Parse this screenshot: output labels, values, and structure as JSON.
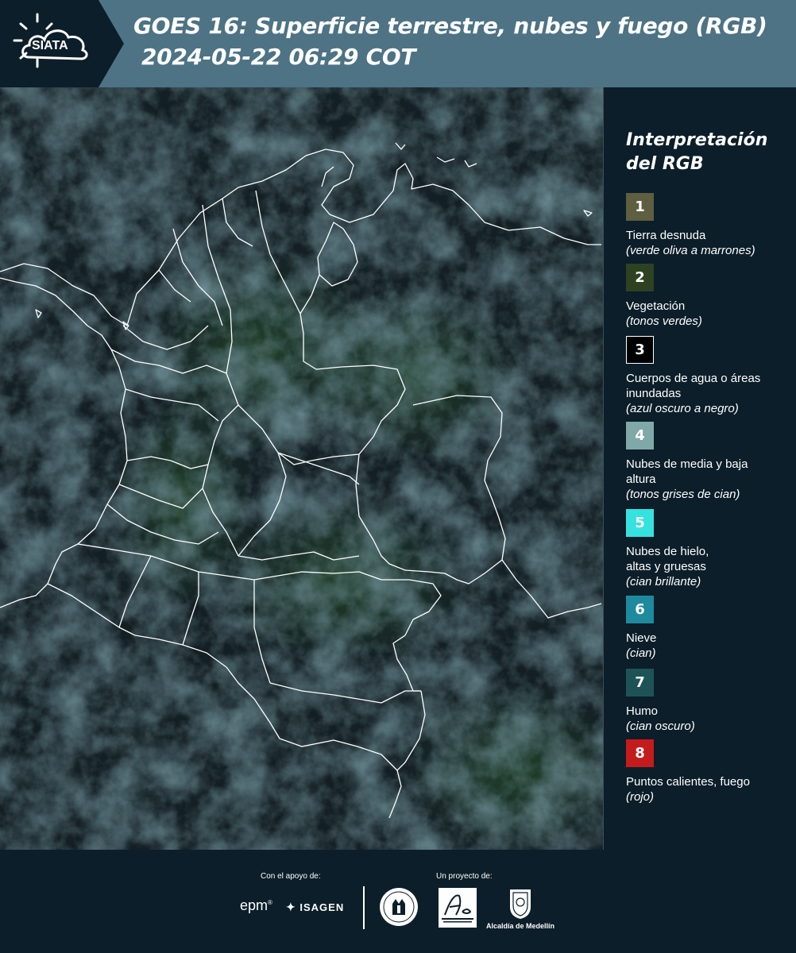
{
  "header": {
    "logo_text": "SIATA",
    "title_line1": "GOES 16: Superficie terrestre, nubes y fuego (RGB)",
    "title_line2": "2024-05-22 06:29 COT",
    "colors": {
      "bar": "#4d7384",
      "logo_bg": "#0c1e29"
    }
  },
  "map": {
    "icon": "satellite-rgb-image",
    "colors": {
      "land": "#1a2a2c",
      "vegetation": "#1d3326",
      "cloud": "#2b4a55",
      "borders": "#ffffff"
    }
  },
  "legend": {
    "title": "Interpretación del RGB",
    "items": [
      {
        "number": "1",
        "color": "#5e5e40",
        "label": "Tierra desnuda",
        "note": "(verde oliva a marrones)"
      },
      {
        "number": "2",
        "color": "#2e4222",
        "label": "Vegetación",
        "note": "(tonos verdes)"
      },
      {
        "number": "3",
        "color": "#000000",
        "label": "Cuerpos de agua o áreas inundadas",
        "note": "(azul oscuro a negro)"
      },
      {
        "number": "4",
        "color": "#7fa9a8",
        "label": "Nubes de media y baja altura",
        "note": "(tonos grises de cian)"
      },
      {
        "number": "5",
        "color": "#35e2e0",
        "label": "Nubes de hielo, altas y gruesas",
        "note": "(cian brillante)"
      },
      {
        "number": "6",
        "color": "#1e8a9e",
        "label": "Nieve",
        "note": "(cian)"
      },
      {
        "number": "7",
        "color": "#1d5357",
        "label": "Humo",
        "note": "(cian oscuro)"
      },
      {
        "number": "8",
        "color": "#c41c1c",
        "label": "Puntos calientes, fuego",
        "note": "(rojo)"
      }
    ]
  },
  "footer": {
    "support_caption": "Con el apoyo de:",
    "project_caption": "Un proyecto de:",
    "brand_epm": "epm",
    "brand_isagen": "ISAGEN",
    "alcaldia": "Alcaldía de Medellín"
  }
}
